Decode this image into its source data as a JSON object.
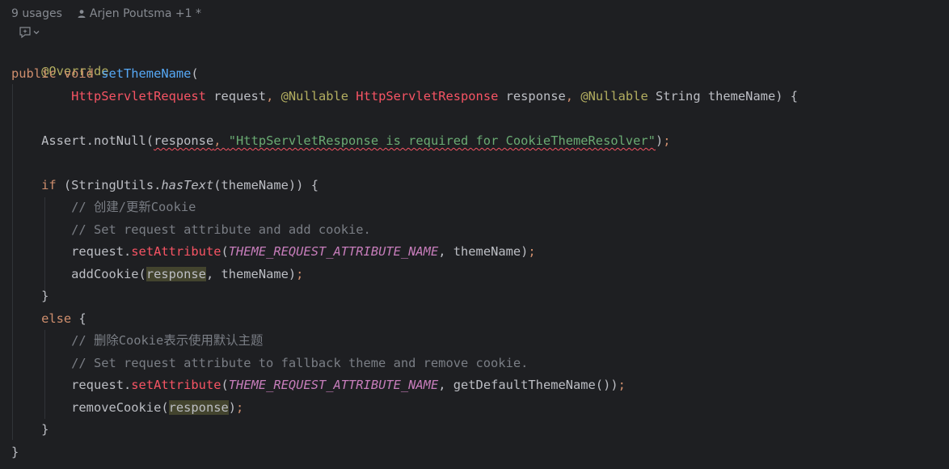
{
  "inlay": {
    "usages": "9 usages",
    "author": "Arjen Poutsma +1 *"
  },
  "code": {
    "l1": {
      "text": "@Override"
    },
    "l2": {
      "kw": "public void ",
      "fn": "setThemeName",
      "rest": "("
    },
    "l3": {
      "indent": "        ",
      "t1": "HttpServletRequest",
      "t2": " request",
      "t3": ", ",
      "t4": "@Nullable ",
      "t5": "HttpServletResponse",
      "t6": " response",
      "t7": ", ",
      "t8": "@Nullable ",
      "t9": "String themeName) {"
    },
    "l4": {
      "indent": "    ",
      "t1": "Assert.notNull(",
      "t2": "response",
      "t3": ", ",
      "t4": "\"HttpServletResponse is required for CookieThemeResolver\"",
      "t5": ")",
      "t6": ";"
    },
    "l5": {
      "indent": "    ",
      "kw": "if",
      "t1": " (StringUtils.",
      "t2": "hasText",
      "t3": "(themeName)) {"
    },
    "l6": {
      "indent": "        ",
      "comment": "// 创建/更新Cookie"
    },
    "l7": {
      "indent": "        ",
      "comment": "// Set request attribute and add cookie."
    },
    "l8": {
      "indent": "        ",
      "t1": "request.",
      "t2": "setAttribute",
      "t3": "(",
      "t4": "THEME_REQUEST_ATTRIBUTE_NAME",
      "t5": ", themeName)",
      "t6": ";"
    },
    "l9": {
      "indent": "        ",
      "t1": "addCookie(",
      "t2": "response",
      "t3": ", themeName)",
      "t4": ";"
    },
    "l10": {
      "indent": "    ",
      "text": "}"
    },
    "l11": {
      "indent": "    ",
      "kw": "else",
      "rest": " {"
    },
    "l12": {
      "indent": "        ",
      "comment": "// 删除Cookie表示使用默认主题"
    },
    "l13": {
      "indent": "        ",
      "comment": "// Set request attribute to fallback theme and remove cookie."
    },
    "l14": {
      "indent": "        ",
      "t1": "request.",
      "t2": "setAttribute",
      "t3": "(",
      "t4": "THEME_REQUEST_ATTRIBUTE_NAME",
      "t5": ", getDefaultThemeName())",
      "t6": ";"
    },
    "l15": {
      "indent": "        ",
      "t1": "removeCookie(",
      "t2": "response",
      "t3": ")",
      "t4": ";"
    },
    "l16": {
      "indent": "    ",
      "text": "}"
    },
    "l17": {
      "text": "}"
    }
  }
}
